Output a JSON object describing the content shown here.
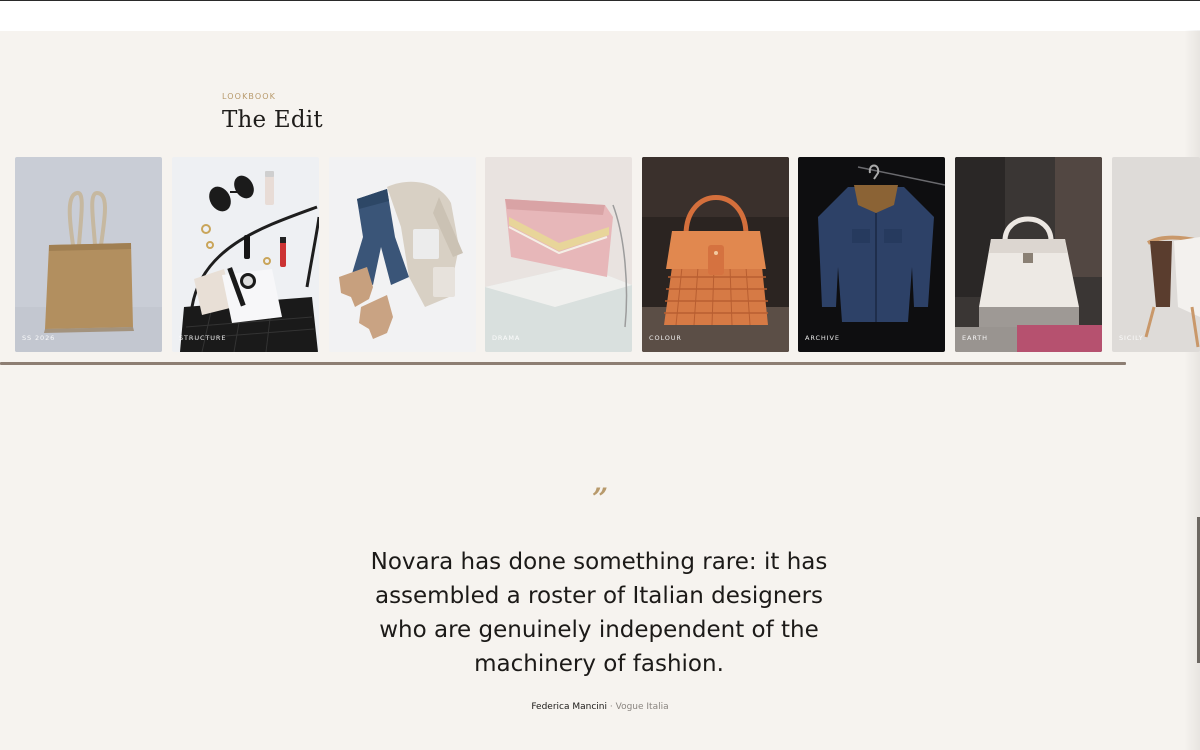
{
  "lookbook": {
    "eyebrow": "LOOKBOOK",
    "title": "The Edit",
    "cards": [
      {
        "label": "SS 2026",
        "image": "tan tote bag on grey background"
      },
      {
        "label": "STRUCTURE",
        "image": "flat lay of sunglasses, watch and black bag"
      },
      {
        "label": "",
        "image": "flat lay of jeans, sweater and boots"
      },
      {
        "label": "DRAMA",
        "image": "pink shoulder bag on white block"
      },
      {
        "label": "COLOUR",
        "image": "orange woven handbag"
      },
      {
        "label": "ARCHIVE",
        "image": "denim jacket on hanger"
      },
      {
        "label": "EARTH",
        "image": "white handbag in shop window"
      },
      {
        "label": "SICILY",
        "image": "clothes on chair"
      }
    ]
  },
  "testimonial": {
    "quote_mark": "”",
    "quote": "Novara has done something rare: it has assembled a roster of Italian designers who are genuinely independent of the machinery of fashion.",
    "author": "Federica Mancini",
    "separator": "·",
    "publication": "Vogue Italia"
  },
  "colors": {
    "page_background": "#f6f3ef",
    "accent_gold": "#b89a6c",
    "text_dark": "#1c1a18",
    "progress_track": "#8d7e73"
  }
}
